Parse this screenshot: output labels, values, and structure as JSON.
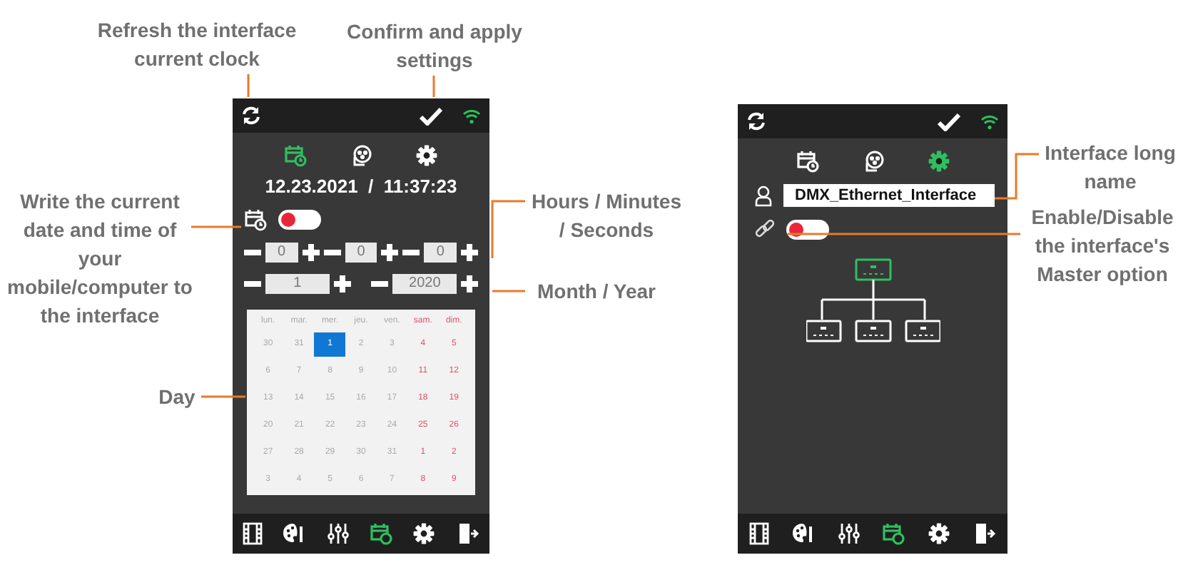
{
  "annotations": [
    {
      "text": "Refresh the interface current clock"
    },
    {
      "text": "Confirm and apply settings"
    },
    {
      "text": "Write the current date and time of your mobile/computer to the interface"
    },
    {
      "text": "Hours / Minutes / Seconds"
    },
    {
      "text": "Month / Year"
    },
    {
      "text": "Day"
    },
    {
      "text": "Interface long name"
    },
    {
      "text": "Enable/Disable the interface's Master option"
    }
  ],
  "left_screen": {
    "tabs": [
      {
        "selected": true
      },
      {
        "selected": false
      },
      {
        "selected": false
      }
    ],
    "datetime": "12.23.2021  /  11:37:23",
    "sync_toggle": {
      "on": false
    },
    "time_fields": [
      "0",
      "0",
      "0"
    ],
    "date_fields": [
      "1",
      "2020"
    ],
    "calendar": {
      "weekdays": [
        {
          "text": "lun.",
          "weekend": false
        },
        {
          "text": "mar.",
          "weekend": false
        },
        {
          "text": "mer.",
          "weekend": false
        },
        {
          "text": "jeu.",
          "weekend": false
        },
        {
          "text": "ven.",
          "weekend": false
        },
        {
          "text": "sam.",
          "weekend": true
        },
        {
          "text": "dim.",
          "weekend": true
        }
      ],
      "weeks": [
        [
          {
            "text": "30",
            "selected": false
          },
          {
            "text": "31",
            "selected": false
          },
          {
            "text": "1",
            "selected": true
          },
          {
            "text": "2",
            "selected": false
          },
          {
            "text": "3",
            "selected": false
          },
          {
            "text": "4",
            "selected": false
          },
          {
            "text": "5",
            "selected": false
          }
        ],
        [
          {
            "text": "6",
            "selected": false
          },
          {
            "text": "7",
            "selected": false
          },
          {
            "text": "8",
            "selected": false
          },
          {
            "text": "9",
            "selected": false
          },
          {
            "text": "10",
            "selected": false
          },
          {
            "text": "11",
            "selected": false
          },
          {
            "text": "12",
            "selected": false
          }
        ],
        [
          {
            "text": "13",
            "selected": false
          },
          {
            "text": "14",
            "selected": false
          },
          {
            "text": "15",
            "selected": false
          },
          {
            "text": "16",
            "selected": false
          },
          {
            "text": "17",
            "selected": false
          },
          {
            "text": "18",
            "selected": false
          },
          {
            "text": "19",
            "selected": false
          }
        ],
        [
          {
            "text": "20",
            "selected": false
          },
          {
            "text": "21",
            "selected": false
          },
          {
            "text": "22",
            "selected": false
          },
          {
            "text": "23",
            "selected": false
          },
          {
            "text": "24",
            "selected": false
          },
          {
            "text": "25",
            "selected": false
          },
          {
            "text": "26",
            "selected": false
          }
        ],
        [
          {
            "text": "27",
            "selected": false
          },
          {
            "text": "28",
            "selected": false
          },
          {
            "text": "29",
            "selected": false
          },
          {
            "text": "30",
            "selected": false
          },
          {
            "text": "31",
            "selected": false
          },
          {
            "text": "1",
            "selected": false
          },
          {
            "text": "2",
            "selected": false
          }
        ],
        [
          {
            "text": "3",
            "selected": false
          },
          {
            "text": "4",
            "selected": false
          },
          {
            "text": "5",
            "selected": false
          },
          {
            "text": "6",
            "selected": false
          },
          {
            "text": "7",
            "selected": false
          },
          {
            "text": "8",
            "selected": false
          },
          {
            "text": "9",
            "selected": false
          }
        ]
      ]
    },
    "nav": [
      {
        "selected": false
      },
      {
        "selected": false
      },
      {
        "selected": false
      },
      {
        "selected": true
      },
      {
        "selected": false
      },
      {
        "selected": false
      }
    ]
  },
  "right_screen": {
    "tabs": [
      {
        "selected": false
      },
      {
        "selected": false
      },
      {
        "selected": true
      }
    ],
    "long_name": "DMX_Ethernet_Interface",
    "master_toggle": {
      "on": false
    },
    "nav": [
      {
        "selected": false
      },
      {
        "selected": false
      },
      {
        "selected": false
      },
      {
        "selected": true
      },
      {
        "selected": false
      },
      {
        "selected": false
      }
    ]
  }
}
